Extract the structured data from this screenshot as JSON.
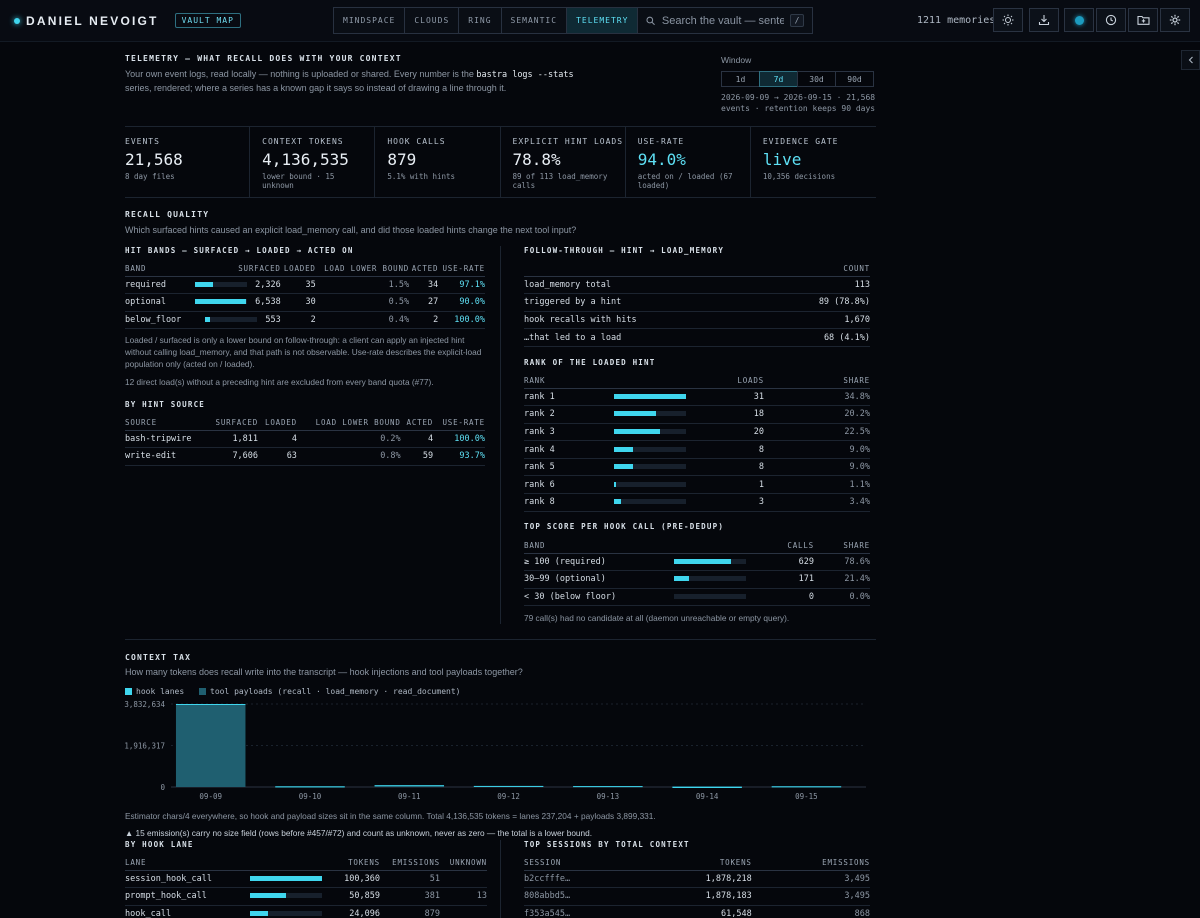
{
  "header": {
    "brand": "DANIEL NEVOIGT",
    "badge": "VAULT MAP",
    "tabs": [
      "MINDSPACE",
      "CLOUDS",
      "RING",
      "SEMANTIC",
      "TELEMETRY"
    ],
    "active_tab": "TELEMETRY",
    "search_placeholder": "Search the vault — sentenc",
    "search_key": "/",
    "memory_count": "1211 memories",
    "colors": {
      "accent": "#3fd6ee",
      "background": "#05070c"
    }
  },
  "intro": {
    "title": "TELEMETRY — WHAT RECALL DOES WITH YOUR CONTEXT",
    "line1_pre": "Your own event logs, read locally — nothing is uploaded or shared. Every number is the ",
    "line1_code": "bastra logs --stats",
    "line2": "series, rendered; where a series has a known gap it says so instead of drawing a line through it."
  },
  "window": {
    "label": "Window",
    "options": [
      "1d",
      "7d",
      "30d",
      "90d"
    ],
    "selected": "7d",
    "range_line1": "2026-09-09 → 2026-09-15 · 21,568",
    "range_line2": "events · retention keeps 90 days"
  },
  "stats": [
    {
      "label": "EVENTS",
      "value": "21,568",
      "sub1": "8 day files",
      "sub2": ""
    },
    {
      "label": "CONTEXT TOKENS",
      "value": "4,136,535",
      "sub1": "lower bound · 15",
      "sub2": "unknown"
    },
    {
      "label": "HOOK CALLS",
      "value": "879",
      "sub1": "5.1% with hints",
      "sub2": ""
    },
    {
      "label": "EXPLICIT HINT LOADS",
      "value": "78.8%",
      "sub1": "89 of 113 load_memory",
      "sub2": "calls"
    },
    {
      "label": "USE-RATE",
      "value": "94.0%",
      "sub1": "acted on / loaded (67",
      "sub2": "loaded)"
    },
    {
      "label": "EVIDENCE GATE",
      "value": "live",
      "sub1": "10,356 decisions",
      "sub2": ""
    }
  ],
  "recall": {
    "title": "RECALL QUALITY",
    "subtitle": "Which surfaced hints caused an explicit load_memory call, and did those loaded hints change the next tool input?",
    "hit_bands": {
      "title": "HIT BANDS — SURFACED → LOADED → ACTED ON",
      "headers": [
        "BAND",
        "SURFACED",
        "LOADED",
        "LOAD LOWER BOUND",
        "ACTED",
        "USE-RATE"
      ],
      "rows": [
        {
          "band": "required",
          "fill": 0.35,
          "surfaced": "2,326",
          "loaded": "35",
          "lower": "1.5%",
          "acted": "34",
          "rate": "97.1%"
        },
        {
          "band": "optional",
          "fill": 0.98,
          "surfaced": "6,538",
          "loaded": "30",
          "lower": "0.5%",
          "acted": "27",
          "rate": "90.0%"
        },
        {
          "band": "below_floor",
          "fill": 0.08,
          "surfaced": "553",
          "loaded": "2",
          "lower": "0.4%",
          "acted": "2",
          "rate": "100.0%"
        }
      ],
      "note": "Loaded / surfaced is only a lower bound on follow-through: a client can apply an injected hint without calling load_memory, and that path is not observable. Use-rate describes the explicit-load population only (acted on / loaded).",
      "note2": "12 direct load(s) without a preceding hint are excluded from every band quota (#77)."
    },
    "hint_source": {
      "title": "BY HINT SOURCE",
      "headers": [
        "SOURCE",
        "SURFACED",
        "LOADED",
        "LOAD LOWER BOUND",
        "ACTED",
        "USE-RATE"
      ],
      "rows": [
        {
          "source": "bash-tripwire",
          "surfaced": "1,811",
          "loaded": "4",
          "lower": "0.2%",
          "acted": "4",
          "rate": "100.0%"
        },
        {
          "source": "write-edit",
          "surfaced": "7,606",
          "loaded": "63",
          "lower": "0.8%",
          "acted": "59",
          "rate": "93.7%"
        }
      ]
    },
    "follow": {
      "title": "FOLLOW-THROUGH — HINT → LOAD_MEMORY",
      "header": "COUNT",
      "rows": [
        {
          "label": "load_memory total",
          "value": "113"
        },
        {
          "label": "triggered by a hint",
          "value": "89 (78.8%)"
        },
        {
          "label": "hook recalls with hits",
          "value": "1,670"
        },
        {
          "label": "…that led to a load",
          "value": "68 (4.1%)"
        }
      ]
    },
    "rank": {
      "title": "RANK OF THE LOADED HINT",
      "headers": [
        "RANK",
        "LOADS",
        "SHARE"
      ],
      "rows": [
        {
          "rank": "rank 1",
          "loads": 31,
          "share": "34.8%"
        },
        {
          "rank": "rank 2",
          "loads": 18,
          "share": "20.2%"
        },
        {
          "rank": "rank 3",
          "loads": 20,
          "share": "22.5%"
        },
        {
          "rank": "rank 4",
          "loads": 8,
          "share": "9.0%"
        },
        {
          "rank": "rank 5",
          "loads": 8,
          "share": "9.0%"
        },
        {
          "rank": "rank 6",
          "loads": 1,
          "share": "1.1%"
        },
        {
          "rank": "rank 8",
          "loads": 3,
          "share": "3.4%"
        }
      ]
    },
    "top_score": {
      "title": "TOP SCORE PER HOOK CALL (PRE-DEDUP)",
      "headers": [
        "BAND",
        "CALLS",
        "SHARE"
      ],
      "rows": [
        {
          "band": "≥ 100 (required)",
          "calls": 629,
          "share": "78.6%"
        },
        {
          "band": "30–99 (optional)",
          "calls": 171,
          "share": "21.4%"
        },
        {
          "band": "< 30 (below floor)",
          "calls": 0,
          "share": "0.0%"
        }
      ],
      "note": "79 call(s) had no candidate at all (daemon unreachable or empty query)."
    }
  },
  "context_tax": {
    "title": "CONTEXT TAX",
    "subtitle": "How many tokens does recall write into the transcript — hook injections and tool payloads together?",
    "legend_hook": "hook lanes",
    "legend_tool": "tool payloads (recall · load_memory · read_document)",
    "estimator": "Estimator chars/4 everywhere, so hook and payload sizes sit in the same column. Total 4,136,535 tokens = lanes 237,204 + payloads 3,899,331.",
    "warning": "▲ 15 emission(s) carry no size field (rows before #457/#72) and count as unknown, never as zero — the total is a lower bound.",
    "hook_lane": {
      "title": "BY HOOK LANE",
      "headers": [
        "LANE",
        "TOKENS",
        "EMISSIONS",
        "UNKNOWN"
      ],
      "rows": [
        {
          "lane": "session_hook_call",
          "fill": 1.0,
          "tokens": "100,360",
          "emissions": "51",
          "unknown": ""
        },
        {
          "lane": "prompt_hook_call",
          "fill": 0.5,
          "tokens": "50,859",
          "emissions": "381",
          "unknown": "13"
        },
        {
          "lane": "hook_call",
          "fill": 0.25,
          "tokens": "24,096",
          "emissions": "879",
          "unknown": ""
        }
      ]
    },
    "sessions": {
      "title": "TOP SESSIONS BY TOTAL CONTEXT",
      "headers": [
        "SESSION",
        "TOKENS",
        "EMISSIONS"
      ],
      "rows": [
        {
          "session": "b2ccfffe…",
          "tokens": "1,878,218",
          "emissions": "3,495"
        },
        {
          "session": "808abbd5…",
          "tokens": "1,878,183",
          "emissions": "3,495"
        },
        {
          "session": "f353a545…",
          "tokens": "61,548",
          "emissions": "868"
        }
      ]
    }
  },
  "chart_data": {
    "type": "bar",
    "categories": [
      "09-09",
      "09-10",
      "09-11",
      "09-12",
      "09-13",
      "09-14",
      "09-15"
    ],
    "series": [
      {
        "name": "hook lanes",
        "values": [
          20000,
          15000,
          40000,
          30000,
          25000,
          0,
          20000
        ]
      },
      {
        "name": "tool payloads (recall · load_memory · read_document)",
        "values": [
          3812634,
          10000,
          45000,
          20000,
          15000,
          0,
          8000
        ]
      }
    ],
    "ytick_labels": [
      "3,832,634",
      "1,916,317",
      "0"
    ],
    "ylim": [
      0,
      3832634
    ],
    "colors": {
      "hook": "#3fd6ee",
      "tool": "#1f5f70"
    }
  }
}
